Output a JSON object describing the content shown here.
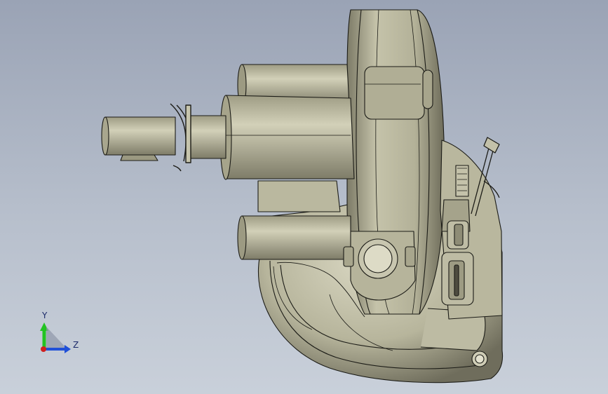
{
  "viewport": {
    "model": "pump assembly",
    "colors": {
      "background_top": "#9aa3b5",
      "background_bottom": "#c9d0da",
      "body_light": "#c3c1a9",
      "body_mid": "#a9a68d",
      "body_dark": "#6f6d5c",
      "outline": "#1b1b16"
    }
  },
  "triad": {
    "y_label": "Y",
    "z_label": "Z",
    "colors": {
      "y_axis": "#22c322",
      "z_axis": "#2050d8",
      "origin": "#d02020"
    }
  }
}
